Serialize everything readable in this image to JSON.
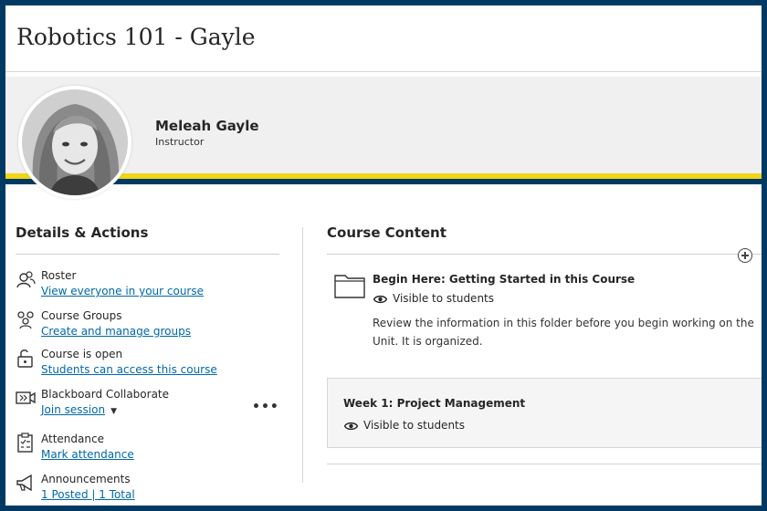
{
  "course": {
    "title": "Robotics 101 - Gayle"
  },
  "instructor": {
    "name": "Meleah Gayle",
    "role": "Instructor"
  },
  "details": {
    "heading": "Details & Actions",
    "items": [
      {
        "label": "Roster",
        "link": "View everyone in your course",
        "icon": "roster-icon"
      },
      {
        "label": "Course Groups",
        "link": "Create and manage groups",
        "icon": "groups-icon"
      },
      {
        "label": "Course is open",
        "link": "Students can access this course",
        "icon": "unlock-icon"
      },
      {
        "label": "Blackboard Collaborate",
        "link": "Join session",
        "icon": "collaborate-icon"
      },
      {
        "label": "Attendance",
        "link": "Mark attendance",
        "icon": "attendance-icon"
      },
      {
        "label": "Announcements",
        "link": "1 Posted | 1 Total",
        "icon": "megaphone-icon"
      }
    ]
  },
  "content": {
    "heading": "Course Content",
    "items": [
      {
        "title": "Begin Here: Getting Started in this Course",
        "visibility": "Visible to students",
        "description": "Review the information in this folder before you begin working on the Unit. It is organized."
      },
      {
        "title": "Week 1: Project Management",
        "visibility": "Visible to students"
      }
    ]
  },
  "colors": {
    "navy": "#003a63",
    "accent_yellow": "#f2d516",
    "link": "#0068a8"
  }
}
